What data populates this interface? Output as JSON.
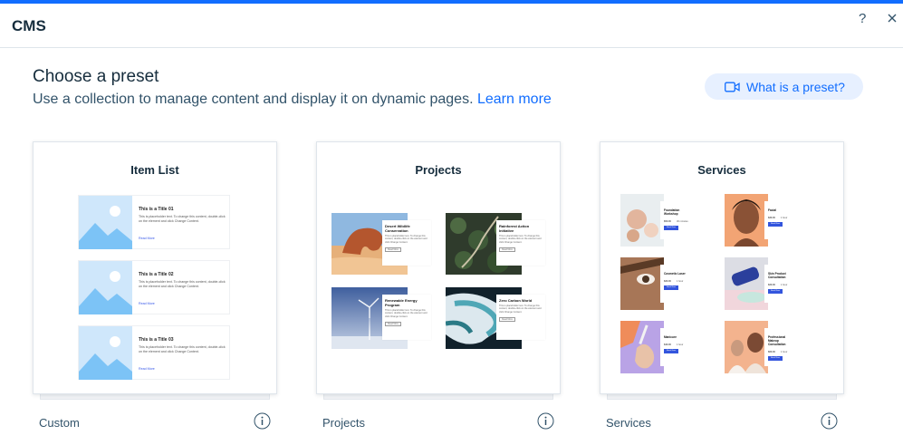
{
  "header": {
    "title": "CMS",
    "help": "?"
  },
  "intro": {
    "title": "Choose a preset",
    "subtitle": "Use a collection to manage content and display it on dynamic pages.",
    "learn_more": "Learn more",
    "preset_pill": "What is a preset?"
  },
  "accent": "#116dff",
  "cards": [
    {
      "heading": "Item List",
      "label": "Custom",
      "items": [
        {
          "title": "This is a Title 01",
          "text": "This is placeholder text. To change this content, double-click on the element and click Change Content.",
          "link": "Read More"
        },
        {
          "title": "This is a Title 02",
          "text": "This is placeholder text. To change this content, double-click on the element and click Change Content.",
          "link": "Read More"
        },
        {
          "title": "This is a Title 03",
          "text": "This is placeholder text. To change this content, double-click on the element and click Change Content.",
          "link": "Read More"
        }
      ]
    },
    {
      "heading": "Projects",
      "label": "Projects",
      "items": [
        {
          "title": "Desert Wildlife Conservation",
          "text": "This is placeholder text. To change this content, double-click on the element and click Change Content.",
          "button": "Read More"
        },
        {
          "title": "Rainforest Action Initiative",
          "text": "This is placeholder text. To change this content, double-click on the element and click Change Content.",
          "button": "Read More"
        },
        {
          "title": "Renewable Energy Program",
          "text": "This is placeholder text. To change this content, double-click on the element and click Change Content.",
          "button": "Read More"
        },
        {
          "title": "Zero Carbon World",
          "text": "This is placeholder text. To change this content, double-click on the element and click Change Content.",
          "button": "Read More"
        }
      ]
    },
    {
      "heading": "Services",
      "label": "Services",
      "items": [
        {
          "title": "Foundation Workshop",
          "price": "$50.00",
          "duration": "30 minutes",
          "button": "Book Now"
        },
        {
          "title": "Facial",
          "price": "$30.00",
          "duration": "1 hour",
          "button": "Book Now"
        },
        {
          "title": "Cosmetic Laser",
          "price": "$20.00",
          "duration": "1 hour",
          "button": "Book Now"
        },
        {
          "title": "Skin Product Consultation",
          "price": "$20.00",
          "duration": "1 hour",
          "button": "Book Now"
        },
        {
          "title": "Manicure",
          "price": "$40.00",
          "duration": "1 hour",
          "button": "Book Now"
        },
        {
          "title": "Professional Makeup Consultation",
          "price": "$60.00",
          "duration": "1 hour",
          "button": "Book Now"
        }
      ]
    }
  ]
}
